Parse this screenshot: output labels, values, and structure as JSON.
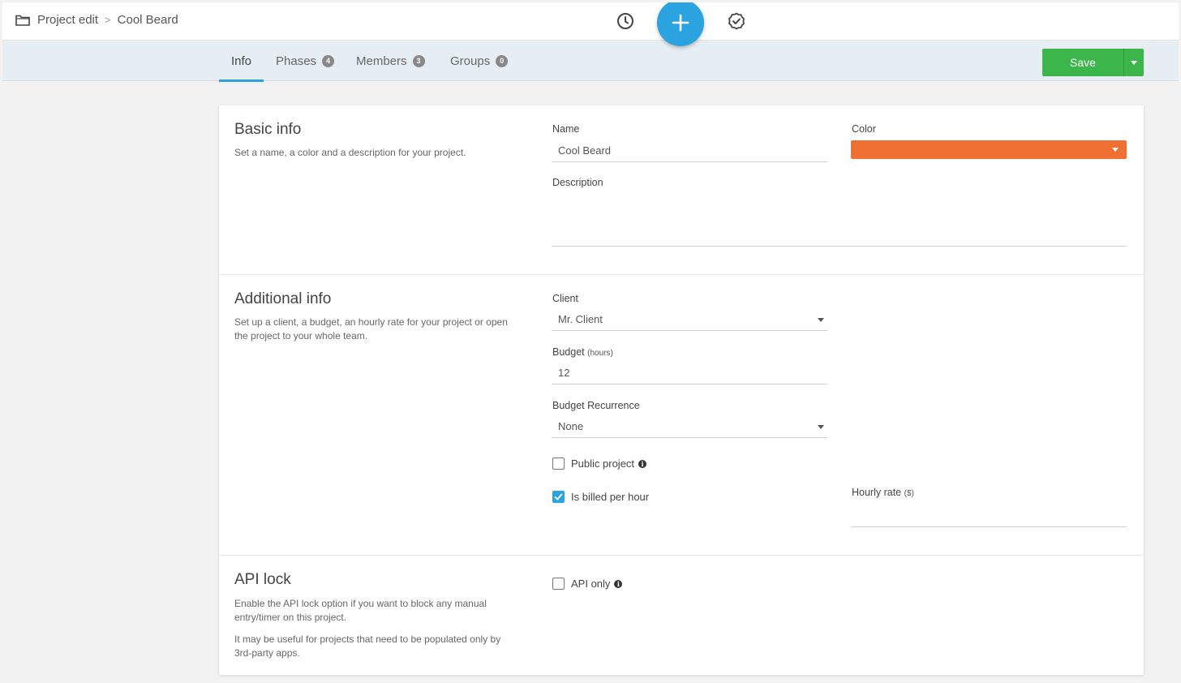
{
  "breadcrumb": {
    "root": "Project edit",
    "current": "Cool Beard"
  },
  "tabs": [
    {
      "label": "Info",
      "count": null
    },
    {
      "label": "Phases",
      "count": "4"
    },
    {
      "label": "Members",
      "count": "3"
    },
    {
      "label": "Groups",
      "count": "0"
    }
  ],
  "toolbar": {
    "save_label": "Save"
  },
  "basic_info": {
    "title": "Basic info",
    "description": "Set a name, a color and a description for your project.",
    "name_label": "Name",
    "name_value": "Cool Beard",
    "color_label": "Color",
    "color_value": "#f07033",
    "description_label": "Description",
    "description_value": ""
  },
  "additional_info": {
    "title": "Additional info",
    "description": "Set up a client, a budget, an hourly rate for your project or open the project to your whole team.",
    "client_label": "Client",
    "client_value": "Mr. Client",
    "budget_label": "Budget",
    "budget_unit": "(hours)",
    "budget_value": "12",
    "recurrence_label": "Budget Recurrence",
    "recurrence_value": "None",
    "public_project_label": "Public project",
    "public_project_checked": false,
    "billed_label": "Is billed per hour",
    "billed_checked": true,
    "hourly_rate_label": "Hourly rate",
    "hourly_rate_unit": "($)",
    "hourly_rate_value": ""
  },
  "api_lock": {
    "title": "API lock",
    "description_1": "Enable the API lock option if you want to block any manual entry/timer on this project.",
    "description_2": "It may be useful for projects that need to be populated only by 3rd-party apps.",
    "api_only_label": "API only",
    "api_only_checked": false
  },
  "icons": {
    "breadcrumb": "folder-icon",
    "history": "clock-icon",
    "add": "plus-icon",
    "done": "check-circle-icon"
  },
  "colors": {
    "accent": "#2aa3e0",
    "save": "#3cb54a",
    "project_color": "#f07033"
  }
}
